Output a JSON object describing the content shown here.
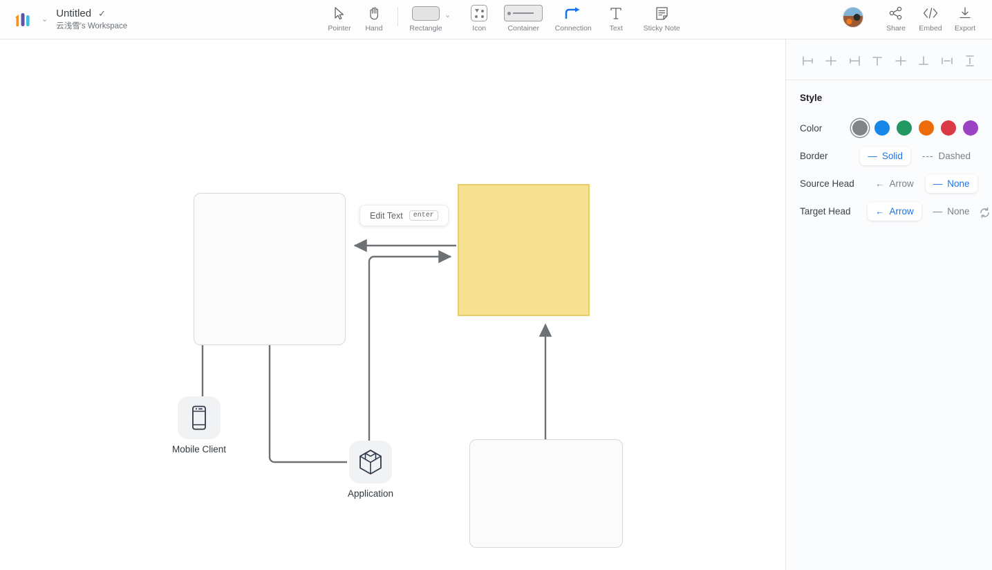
{
  "header": {
    "logo_name": "logo",
    "doc_title": "Untitled",
    "saved_check": "✓",
    "workspace": "云浅雪's Workspace",
    "brand_caret": "⌄",
    "tools": [
      {
        "id": "pointer",
        "label": "Pointer"
      },
      {
        "id": "hand",
        "label": "Hand"
      },
      {
        "id": "rectangle",
        "label": "Rectangle"
      },
      {
        "id": "icon",
        "label": "Icon"
      },
      {
        "id": "container",
        "label": "Container"
      },
      {
        "id": "connection",
        "label": "Connection"
      },
      {
        "id": "text",
        "label": "Text"
      },
      {
        "id": "sticky-note",
        "label": "Sticky Note"
      }
    ],
    "rectangle_caret": "⌄",
    "right_tools": [
      {
        "id": "share",
        "label": "Share"
      },
      {
        "id": "embed",
        "label": "Embed"
      },
      {
        "id": "export",
        "label": "Export"
      }
    ]
  },
  "canvas": {
    "tooltip": {
      "label": "Edit Text",
      "key": "enter"
    },
    "nodes": [
      {
        "id": "mobile-client",
        "label": "Mobile Client",
        "icon": "mobile-phone-icon"
      },
      {
        "id": "application",
        "label": "Application",
        "icon": "cube-icon"
      }
    ],
    "shapes": [
      {
        "id": "rect-top-left",
        "type": "rectangle"
      },
      {
        "id": "sticky-note-yellow",
        "type": "sticky-note",
        "color": "#f5e18f"
      },
      {
        "id": "rect-bottom-right",
        "type": "rectangle"
      }
    ]
  },
  "panel": {
    "align_buttons": [
      "align-left-icon",
      "align-center-horizontal-icon",
      "align-right-icon",
      "align-top-icon",
      "align-middle-vertical-icon",
      "align-bottom-icon",
      "distribute-horizontal-icon",
      "distribute-vertical-icon"
    ],
    "title": "Style",
    "color": {
      "label": "Color",
      "swatches": [
        "#7f8489",
        "#1787e8",
        "#229960",
        "#ec6c09",
        "#d93a45",
        "#9c42c4"
      ],
      "selected_index": 0
    },
    "border": {
      "label": "Border",
      "options": [
        {
          "id": "solid",
          "label": "Solid",
          "mark": "—",
          "selected": true
        },
        {
          "id": "dashed",
          "label": "Dashed",
          "mark": "---",
          "selected": false
        }
      ]
    },
    "source_head": {
      "label": "Source Head",
      "options": [
        {
          "id": "arrow",
          "label": "Arrow",
          "mark": "←",
          "selected": false
        },
        {
          "id": "none",
          "label": "None",
          "mark": "—",
          "selected": true
        }
      ]
    },
    "target_head": {
      "label": "Target Head",
      "options": [
        {
          "id": "arrow",
          "label": "Arrow",
          "mark": "←",
          "selected": true
        },
        {
          "id": "none",
          "label": "None",
          "mark": "—",
          "selected": false
        }
      ]
    },
    "swap_icon": "swap-heads-icon"
  }
}
